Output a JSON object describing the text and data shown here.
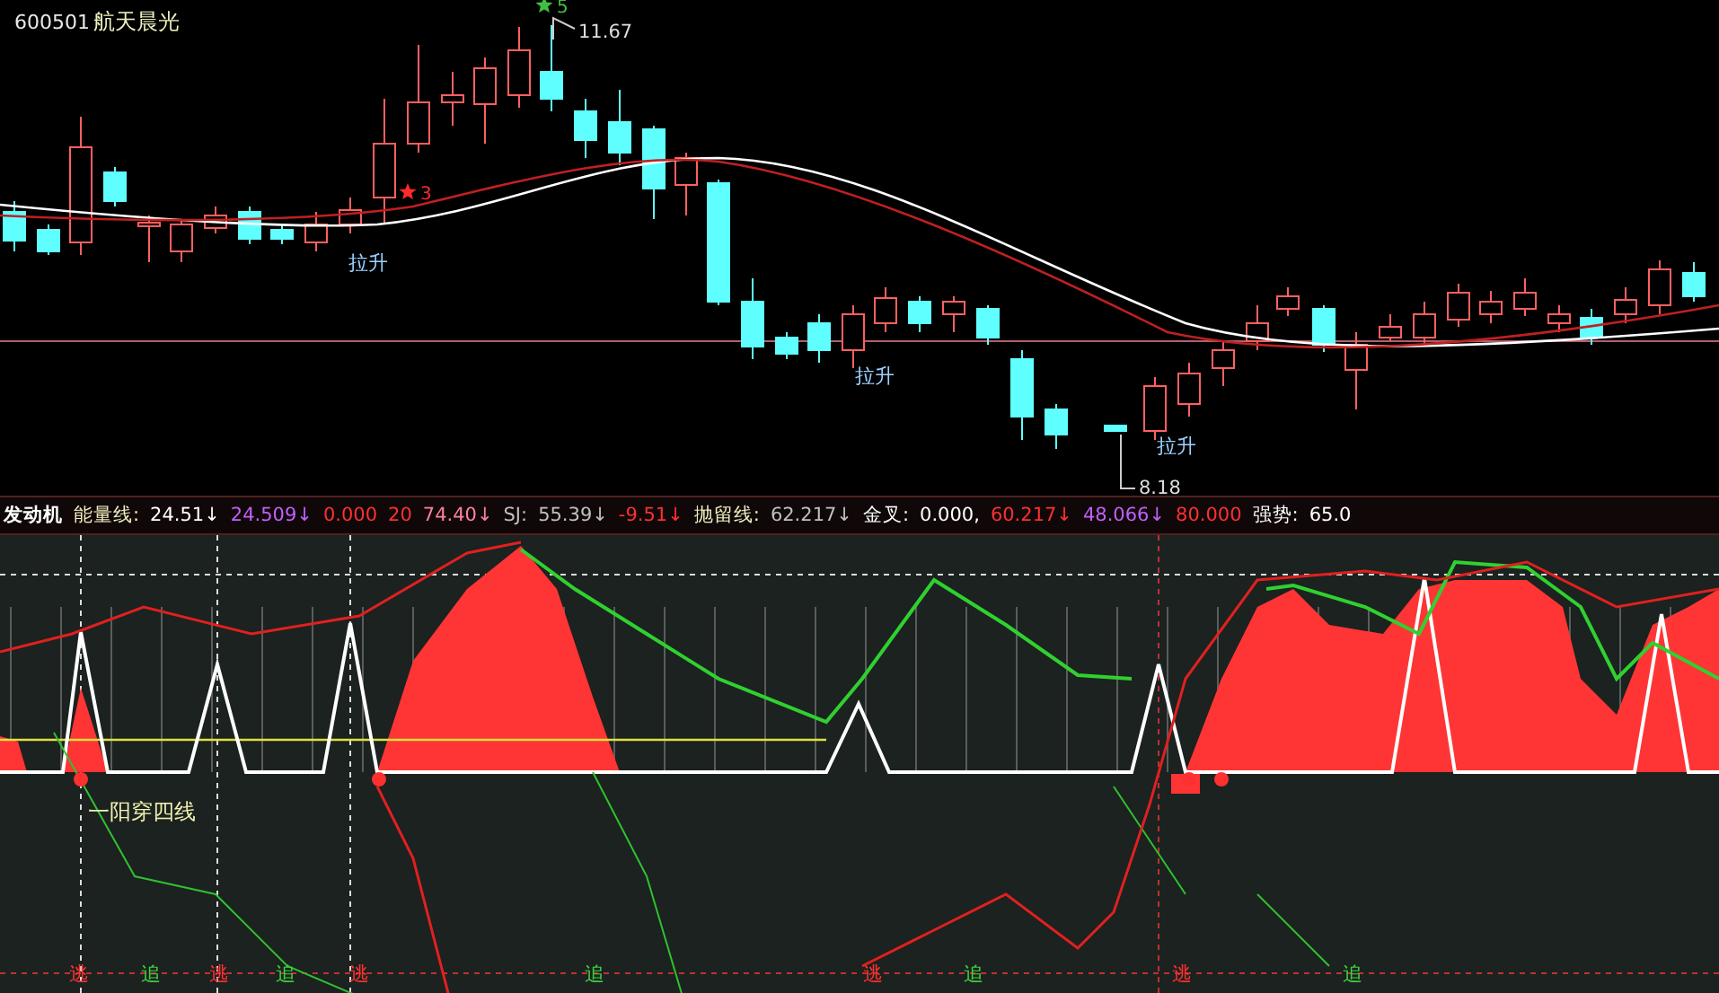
{
  "stock": {
    "code": "600501",
    "name": "航天晨光"
  },
  "price_labels": [
    {
      "kind": "high",
      "text": "11.67"
    },
    {
      "kind": "low",
      "text": "8.18"
    }
  ],
  "signal_marks": [
    {
      "text": "5",
      "color": "#40c040"
    },
    {
      "text": "3",
      "color": "#ff2a2a"
    }
  ],
  "rise_labels": [
    "拉升",
    "拉升",
    "拉升"
  ],
  "indicator_header": {
    "title": "发动机",
    "readings": [
      {
        "text": "能量线:",
        "color": "#f0f0c0"
      },
      {
        "text": "24.51↓",
        "color": "#ffffff"
      },
      {
        "text": "24.509↓",
        "color": "#c060ff"
      },
      {
        "text": "0.000",
        "color": "#ff3030"
      },
      {
        "text": "20",
        "color": "#ff3030"
      },
      {
        "text": "74.40↓",
        "color": "#ff80a0"
      },
      {
        "text": "SJ:",
        "color": "#c0c0c0"
      },
      {
        "text": "55.39↓",
        "color": "#c0c0c0"
      },
      {
        "text": "-9.51↓",
        "color": "#ff3030"
      },
      {
        "text": "抛留线:",
        "color": "#f0f0c0"
      },
      {
        "text": "62.217↓",
        "color": "#c0c0c0"
      },
      {
        "text": "金叉:",
        "color": "#ffffff"
      },
      {
        "text": "0.000,",
        "color": "#ffffff"
      },
      {
        "text": "60.217↓",
        "color": "#ff3030"
      },
      {
        "text": "48.066↓",
        "color": "#c060ff"
      },
      {
        "text": "80.000",
        "color": "#ff3030"
      },
      {
        "text": "强势:",
        "color": "#ffffff"
      },
      {
        "text": "65.0",
        "color": "#ffffff"
      }
    ]
  },
  "pattern_label": "一阳穿四线",
  "bottom_signals": [
    {
      "kind": "escape",
      "text": "逃"
    },
    {
      "kind": "chase",
      "text": "追"
    },
    {
      "kind": "escape",
      "text": "逃"
    },
    {
      "kind": "chase",
      "text": "追"
    },
    {
      "kind": "escape",
      "text": "逃"
    },
    {
      "kind": "chase",
      "text": "追"
    },
    {
      "kind": "escape",
      "text": "逃"
    },
    {
      "kind": "chase",
      "text": "追"
    },
    {
      "kind": "escape",
      "text": "逃"
    },
    {
      "kind": "chase",
      "text": "追"
    }
  ]
}
